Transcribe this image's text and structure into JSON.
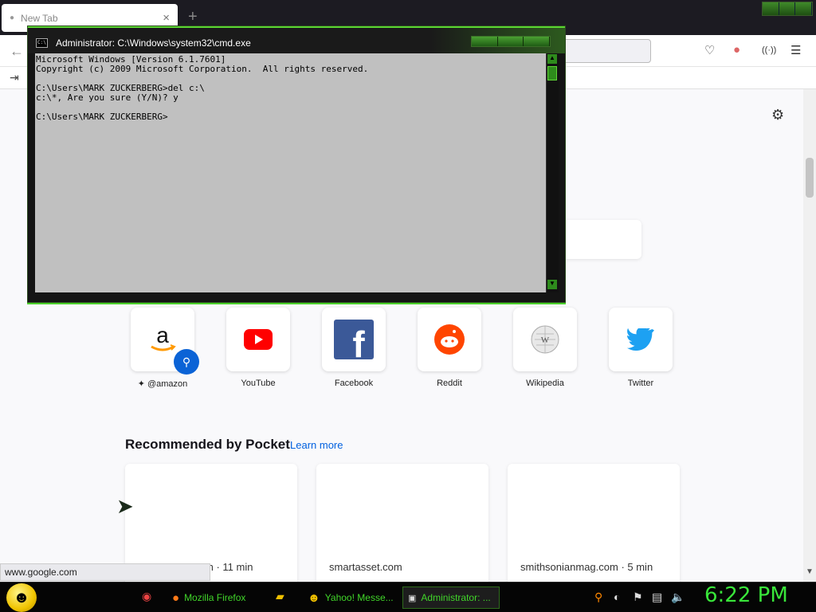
{
  "browser": {
    "tab_title": "New Tab",
    "tab_close_glyph": "×",
    "new_tab_glyph": "+"
  },
  "newtab": {
    "top_sites": [
      {
        "label": "@amazon",
        "icon": "amazon-logo"
      },
      {
        "label": "YouTube",
        "icon": "youtube-logo"
      },
      {
        "label": "Facebook",
        "icon": "facebook-logo"
      },
      {
        "label": "Reddit",
        "icon": "reddit-logo"
      },
      {
        "label": "Wikipedia",
        "icon": "wikipedia-logo"
      },
      {
        "label": "Twitter",
        "icon": "twitter-logo"
      }
    ],
    "pocket": {
      "heading": "Recommended by Pocket",
      "learn_more": "Learn more",
      "cards": [
        {
          "source": "m · 11 min"
        },
        {
          "source": "smartasset.com"
        },
        {
          "source": "smithsonianmag.com · 5 min"
        }
      ]
    }
  },
  "statusbar": {
    "url": "www.google.com"
  },
  "cmd": {
    "title": "Administrator: C:\\Windows\\system32\\cmd.exe",
    "icon_text": "C:\\",
    "lines": [
      "Microsoft Windows [Version 6.1.7601]",
      "Copyright (c) 2009 Microsoft Corporation.  All rights reserved.",
      "",
      "C:\\Users\\MARK ZUCKERBERG>del c:\\",
      "c:\\*, Are you sure (Y/N)? y",
      "",
      "C:\\Users\\MARK ZUCKERBERG>"
    ]
  },
  "taskbar": {
    "items": [
      {
        "label": "Mozilla Firefox",
        "icon": "firefox-icon"
      },
      {
        "label": "Yahoo! Messe...",
        "icon": "yahoo-messenger-icon"
      },
      {
        "label": "Administrator: ...",
        "icon": "cmd-icon"
      }
    ],
    "clock": "6:22 PM"
  },
  "colors": {
    "accent_green": "#41d62a",
    "link_blue": "#0060df",
    "console_bg": "#c0c0c0"
  }
}
